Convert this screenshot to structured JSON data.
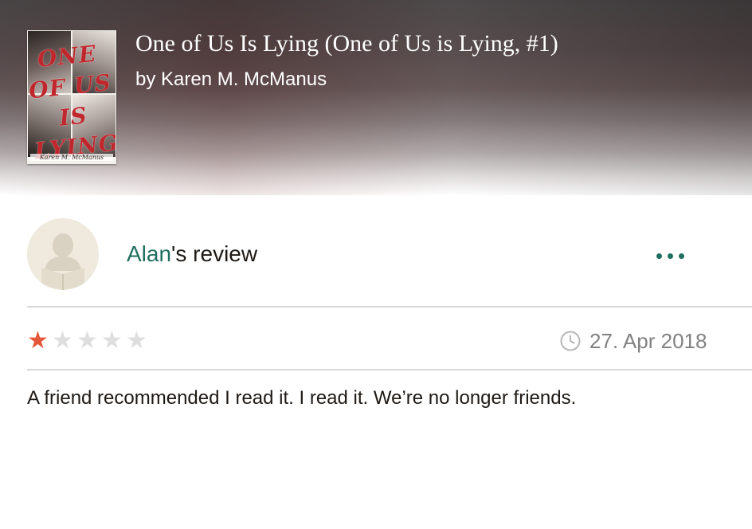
{
  "book": {
    "title": "One of Us Is Lying (One of Us is Lying, #1)",
    "author_line": "by Karen M. McManus",
    "cover": {
      "title_text": "ONE\nOF US\nIS LYING",
      "author_text": "Karen M. McManus"
    }
  },
  "review": {
    "avatar_icon": "reader-silhouette-icon",
    "reviewer_name": "Alan",
    "heading_suffix": "'s review",
    "more_icon": "more-dots-icon",
    "rating": 1,
    "rating_max": 5,
    "date_icon": "clock-icon",
    "date": "27. Apr 2018",
    "text": "A friend recommended I read it. I read it. We’re no longer friends."
  },
  "colors": {
    "accent": "#1f6f5f",
    "star_filled": "#e5573a",
    "star_empty": "#dedede",
    "date_text": "#828282"
  }
}
